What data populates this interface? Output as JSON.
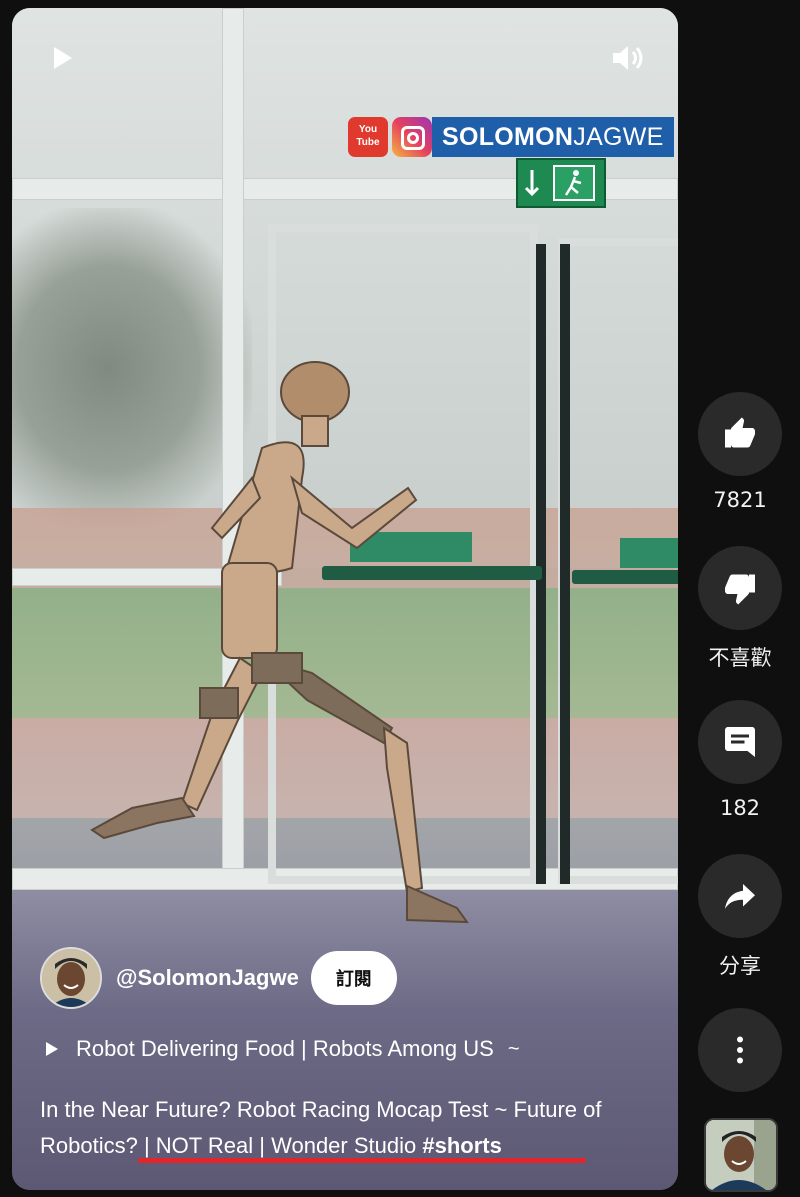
{
  "video": {
    "watermark": {
      "yt_label": "You Tube",
      "name_bold": "SOLOMON",
      "name_light": "JAGWE"
    },
    "channel": {
      "handle": "@SolomonJagwe",
      "subscribe_label": "訂閱"
    },
    "playlist_text": "Robot Delivering Food | Robots Among US",
    "playlist_more": "~",
    "description_text": "In the Near Future? Robot Racing Mocap Test ~ Future of Robotics? | NOT Real | Wonder Studio ",
    "description_tag": "#shorts"
  },
  "rail": {
    "like_count": "7821",
    "dislike_label": "不喜歡",
    "comment_count": "182",
    "share_label": "分享"
  },
  "icons": [
    "play-icon",
    "volume-icon",
    "thumbs-up-icon",
    "thumbs-down-icon",
    "comment-icon",
    "share-icon",
    "more-vert-icon"
  ],
  "colors": {
    "background": "#0f0f0f",
    "rail_button": "#2a2a2a",
    "progress": "#e0262b",
    "watermark_blue": "#1f5ea8"
  }
}
